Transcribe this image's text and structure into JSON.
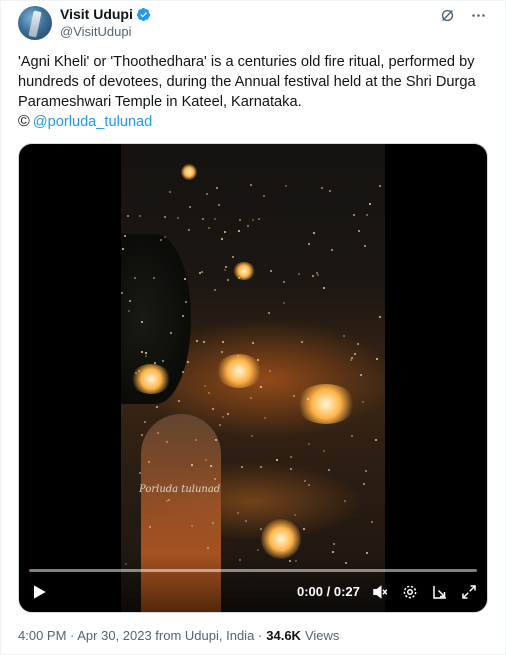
{
  "author": {
    "display_name": "Visit Udupi",
    "handle": "@VisitUdupi",
    "verified": true
  },
  "tweet": {
    "text": "'Agni Kheli' or 'Thoothedhara' is a centuries old fire ritual, performed by hundreds of devotees, during the Annual festival held at the Shri Durga Parameshwari Temple in Kateel, Karnataka.",
    "credit_symbol": "©",
    "credit_mention": "@porluda_tulunad"
  },
  "video": {
    "watermark": "Porluda tulunad",
    "time": "0:00 / 0:27",
    "progress": 0
  },
  "meta": {
    "timestamp": "4:00 PM · Apr 30, 2023 from Udupi, India · ",
    "views_count": "34.6K",
    "views_label": "Views"
  },
  "colors": {
    "accent": "#1d9bf0",
    "text_primary": "#0f1419",
    "text_secondary": "#536471"
  }
}
